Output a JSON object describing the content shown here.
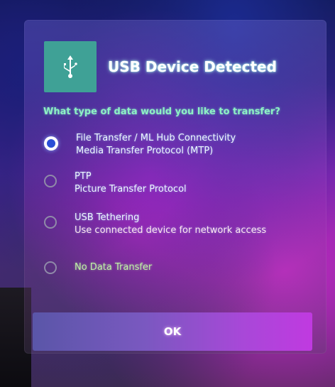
{
  "dialog": {
    "title": "USB Device Detected",
    "icon": "usb-icon",
    "question": "What type of data would you like to transfer?",
    "options": [
      {
        "label": "File Transfer / ML Hub Connectivity",
        "description": "Media Transfer Protocol (MTP)",
        "selected": true
      },
      {
        "label": "PTP",
        "description": "Picture Transfer Protocol",
        "selected": false
      },
      {
        "label": "USB Tethering",
        "description": "Use connected device for network access",
        "selected": false
      },
      {
        "label": "No Data Transfer",
        "description": "",
        "selected": false
      }
    ],
    "ok_label": "OK"
  },
  "colors": {
    "icon_tile": "#3fa196",
    "question_text": "#8ef0c4",
    "radio_selected": "#2a4fd6"
  }
}
